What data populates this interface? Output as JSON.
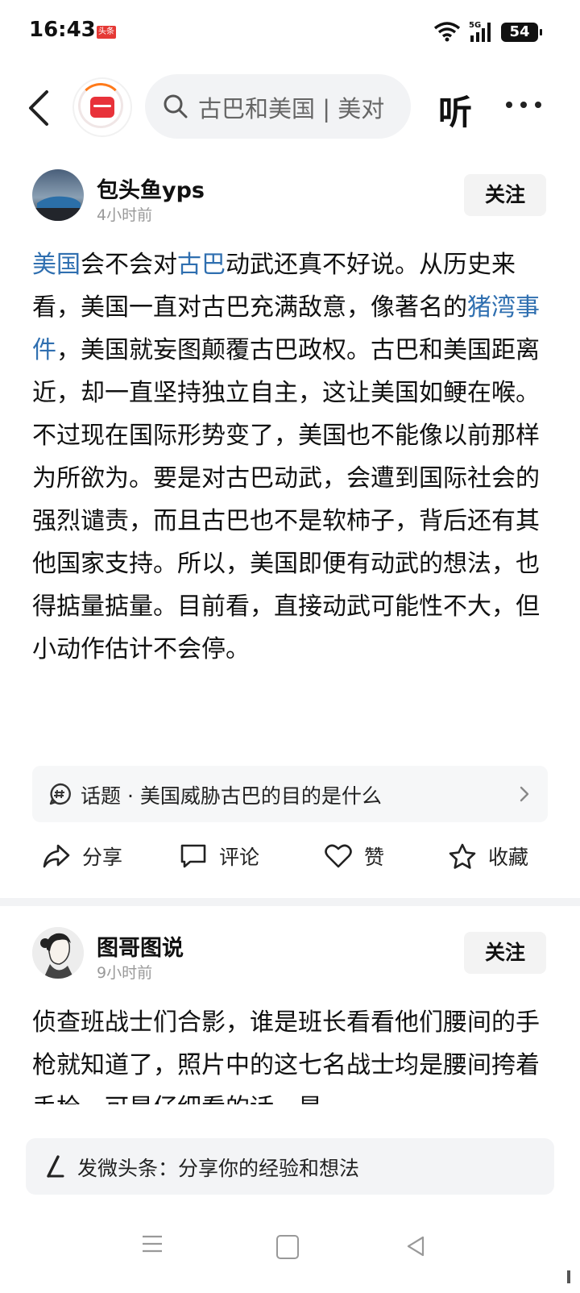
{
  "status_bar": {
    "time": "16:43",
    "app_badge": "头条",
    "network": "5G",
    "battery": "54"
  },
  "nav": {
    "search_placeholder": "古巴和美国 | 美对",
    "listen_label": "听"
  },
  "posts": [
    {
      "author": "包头鱼yps",
      "time": "4小时前",
      "follow_label": "关注",
      "paragraphs": [
        [
          {
            "text": "美国",
            "link": true
          },
          {
            "text": "会不会对",
            "link": false
          },
          {
            "text": "古巴",
            "link": true
          },
          {
            "text": "动武还真不好说。从历史来看，美国一直对古巴充满敌意，像著名的",
            "link": false
          },
          {
            "text": "猪湾事件",
            "link": true
          },
          {
            "text": "，美国就妄图颠覆古巴政权。古巴和美国距离近，却一直坚持独立自主，这让美国如鲠在喉。",
            "link": false
          }
        ],
        [
          {
            "text": "不过现在国际形势变了，美国也不能像以前那样为所欲为。要是对古巴动武，会遭到国际社会的强烈谴责，而且古巴也不是软柿子，背后还有其他国家支持。所以，美国即便有动武的想法，也得掂量掂量。目前看，直接动武可能性不大，但小动作估计不会停。",
            "link": false
          }
        ]
      ],
      "topic": "话题 · 美国威胁古巴的目的是什么",
      "actions": {
        "share": "分享",
        "comment": "评论",
        "like": "赞",
        "favorite": "收藏"
      }
    },
    {
      "author": "图哥图说",
      "time": "9小时前",
      "follow_label": "关注",
      "text": "侦查班战士们合影，谁是班长看看他们腰间的手枪就知道了，照片中的这七名战士均是腰间挎着手枪，可是仔细看的话，是"
    }
  ],
  "composer": {
    "placeholder": "发微头条：分享你的经验和想法"
  },
  "colors": {
    "link": "#2f6fb0",
    "accent_red": "#e8323a",
    "accent_orange": "#ff7a1a"
  },
  "icons": [
    "back-icon",
    "search-icon",
    "more-icon",
    "topic-icon",
    "chevron-right-icon",
    "share-icon",
    "comment-icon",
    "heart-icon",
    "star-icon",
    "pen-icon",
    "menu-icon",
    "home-icon",
    "back-triangle-icon"
  ]
}
